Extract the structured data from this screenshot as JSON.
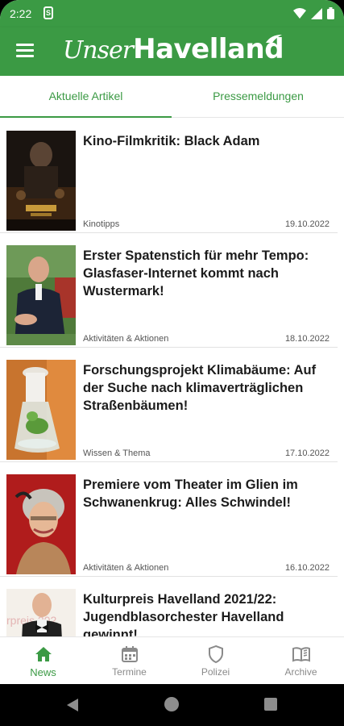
{
  "status_bar": {
    "time": "2:22",
    "sim_glyph": "S"
  },
  "app_bar": {
    "logo_script": "Unser",
    "logo_bold": "Havelland"
  },
  "tabs": [
    {
      "label": "Aktuelle Artikel",
      "active": true
    },
    {
      "label": "Pressemeldungen",
      "active": false
    }
  ],
  "articles": [
    {
      "title": "Kino-Filmkritik: Black Adam",
      "category": "Kinotipps",
      "date": "19.10.2022",
      "thumb": "movie-poster"
    },
    {
      "title": "Erster Spatenstich für mehr Tempo: Glasfaser-Internet kommt nach Wustermark!",
      "category": "Aktivitäten & Aktionen",
      "date": "18.10.2022",
      "thumb": "man-portrait"
    },
    {
      "title": "Forschungsprojekt Klimabäume: Auf der Suche nach klimaverträglichen Straßenbäumen!",
      "category": "Wissen & Thema",
      "date": "17.10.2022",
      "thumb": "glass-plant"
    },
    {
      "title": "Premiere vom Theater im Glien im Schwanenkrug: Alles Schwindel!",
      "category": "Aktivitäten & Aktionen",
      "date": "16.10.2022",
      "thumb": "woman-portrait"
    },
    {
      "title": "Kulturpreis Havelland 2021/22: Jugendblasorchester Havelland gewinnt!",
      "category": "",
      "date": "",
      "thumb": "man-bowtie",
      "thumb_text": "rpreis 202"
    }
  ],
  "bottom_nav": [
    {
      "label": "News",
      "icon": "home-icon",
      "active": true
    },
    {
      "label": "Termine",
      "icon": "calendar-icon",
      "active": false
    },
    {
      "label": "Polizei",
      "icon": "shield-icon",
      "active": false
    },
    {
      "label": "Archive",
      "icon": "book-open-icon",
      "active": false
    }
  ],
  "colors": {
    "brand_green": "#3b9a44",
    "inactive_gray": "#8a8a8a",
    "text_dark": "#1c1c1c"
  }
}
